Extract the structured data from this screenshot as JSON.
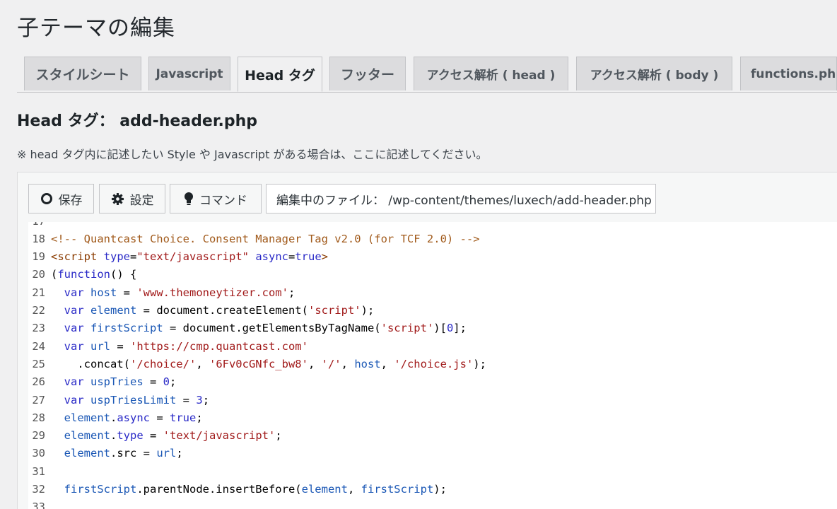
{
  "page_title": "子テーマの編集",
  "tabs": [
    {
      "label": "スタイルシート"
    },
    {
      "label": "Javascript"
    },
    {
      "label": "Head タグ"
    },
    {
      "label": "フッター"
    },
    {
      "label": "アクセス解析 ( head )"
    },
    {
      "label": "アクセス解析 ( body )"
    },
    {
      "label": "functions.php"
    }
  ],
  "active_tab": "Head タグ",
  "section": {
    "title": "Head タグ： add-header.php",
    "note": "※ head タグ内に記述したい Style や Javascript がある場合は、ここに記述してください。"
  },
  "toolbar": {
    "save_label": "保存",
    "settings_label": "設定",
    "command_label": "コマンド",
    "file_label": "編集中のファイル： /wp-content/themes/luxech/add-header.php"
  },
  "code_lines": [
    {
      "n": "17",
      "text": ""
    },
    {
      "n": "18",
      "text": "<!-- Quantcast Choice. Consent Manager Tag v2.0 (for TCF 2.0) -->"
    },
    {
      "n": "19",
      "text": "<script type=\"text/javascript\" async=true>"
    },
    {
      "n": "20",
      "text": "(function() {"
    },
    {
      "n": "21",
      "text": "  var host = 'www.themoneytizer.com';"
    },
    {
      "n": "22",
      "text": "  var element = document.createElement('script');"
    },
    {
      "n": "23",
      "text": "  var firstScript = document.getElementsByTagName('script')[0];"
    },
    {
      "n": "24",
      "text": "  var url = 'https://cmp.quantcast.com'"
    },
    {
      "n": "25",
      "text": "    .concat('/choice/', '6Fv0cGNfc_bw8', '/', host, '/choice.js');"
    },
    {
      "n": "26",
      "text": "  var uspTries = 0;"
    },
    {
      "n": "27",
      "text": "  var uspTriesLimit = 3;"
    },
    {
      "n": "28",
      "text": "  element.async = true;"
    },
    {
      "n": "29",
      "text": "  element.type = 'text/javascript';"
    },
    {
      "n": "30",
      "text": "  element.src = url;"
    },
    {
      "n": "31",
      "text": ""
    },
    {
      "n": "32",
      "text": "  firstScript.parentNode.insertBefore(element, firstScript);"
    },
    {
      "n": "33",
      "text": ""
    }
  ],
  "icons": {
    "save": "circle-icon",
    "settings": "gear-icon",
    "command": "bulb-icon"
  }
}
